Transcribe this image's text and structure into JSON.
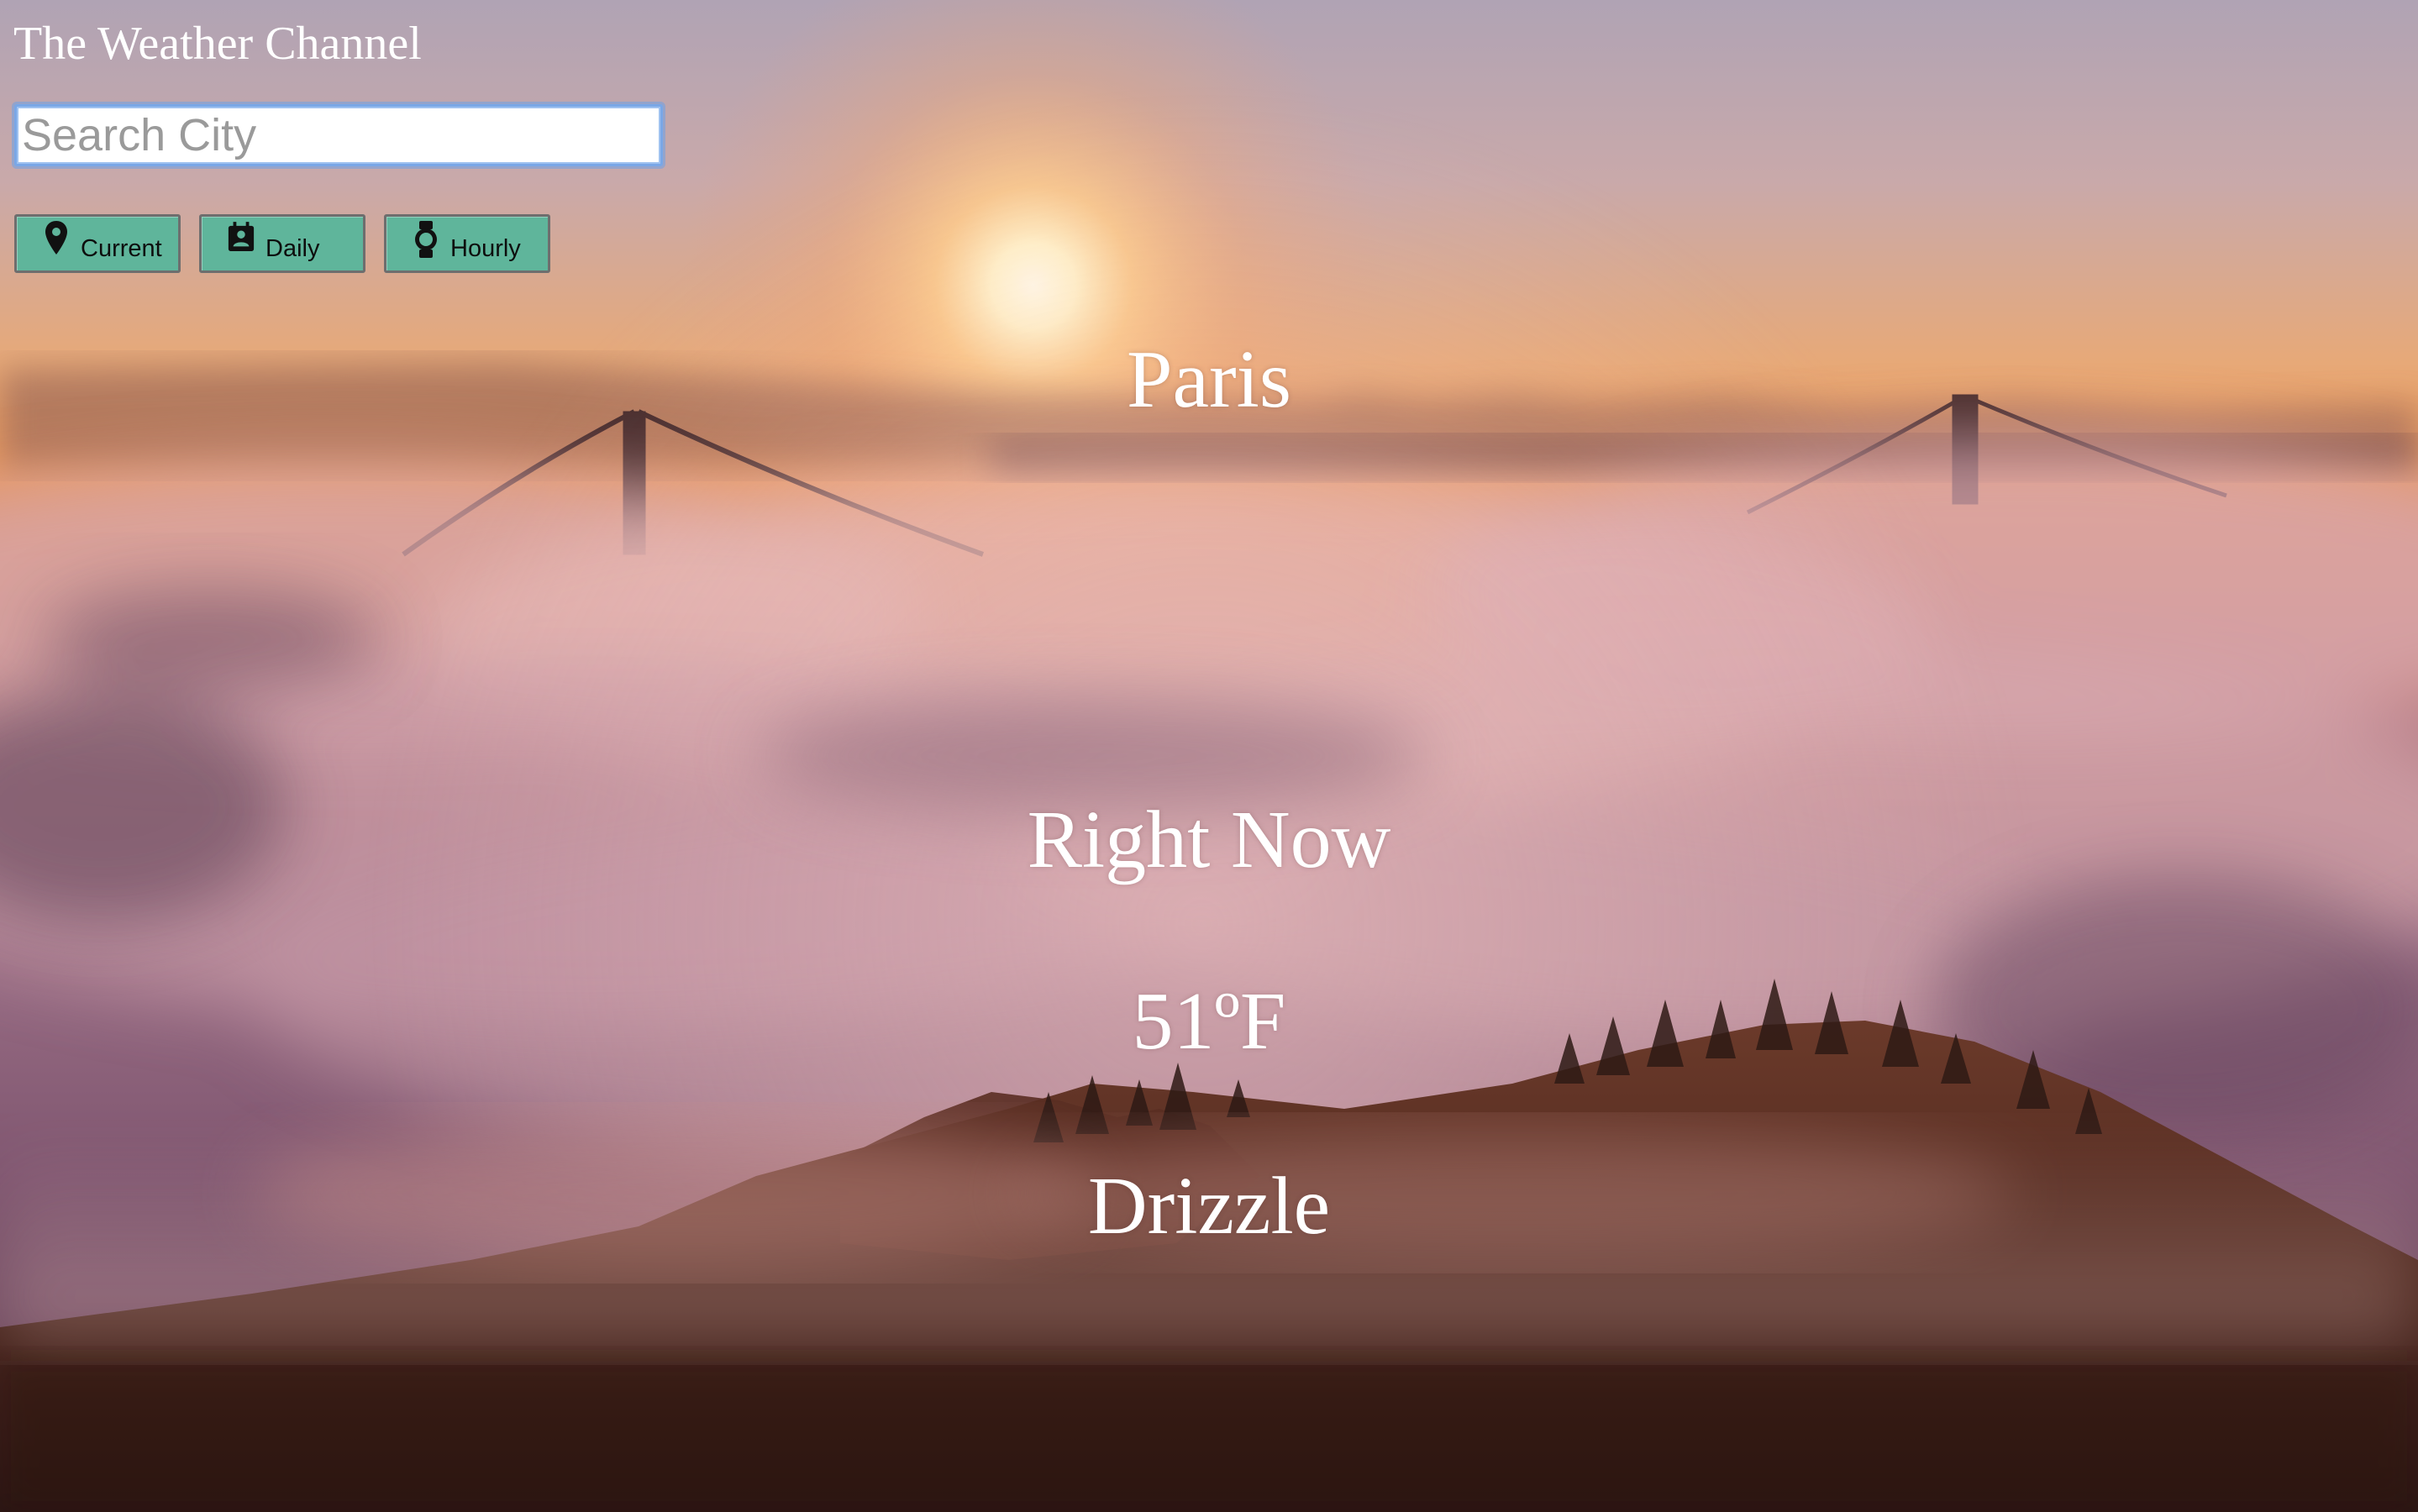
{
  "app": {
    "title": "The Weather Channel"
  },
  "search": {
    "placeholder": "Search City",
    "value": ""
  },
  "nav": {
    "buttons": [
      {
        "label": "Current",
        "icon": "map-marker-icon"
      },
      {
        "label": "Daily",
        "icon": "calendar-contact-icon"
      },
      {
        "label": "Hourly",
        "icon": "watch-icon"
      }
    ]
  },
  "weather": {
    "city": "Paris",
    "period": "Right Now",
    "temperature": "51ºF",
    "condition": "Drizzle"
  },
  "theme": {
    "button_color": "#5fb59b",
    "text_color": "#ffffff",
    "search_focus_color": "#7aa7e6"
  }
}
